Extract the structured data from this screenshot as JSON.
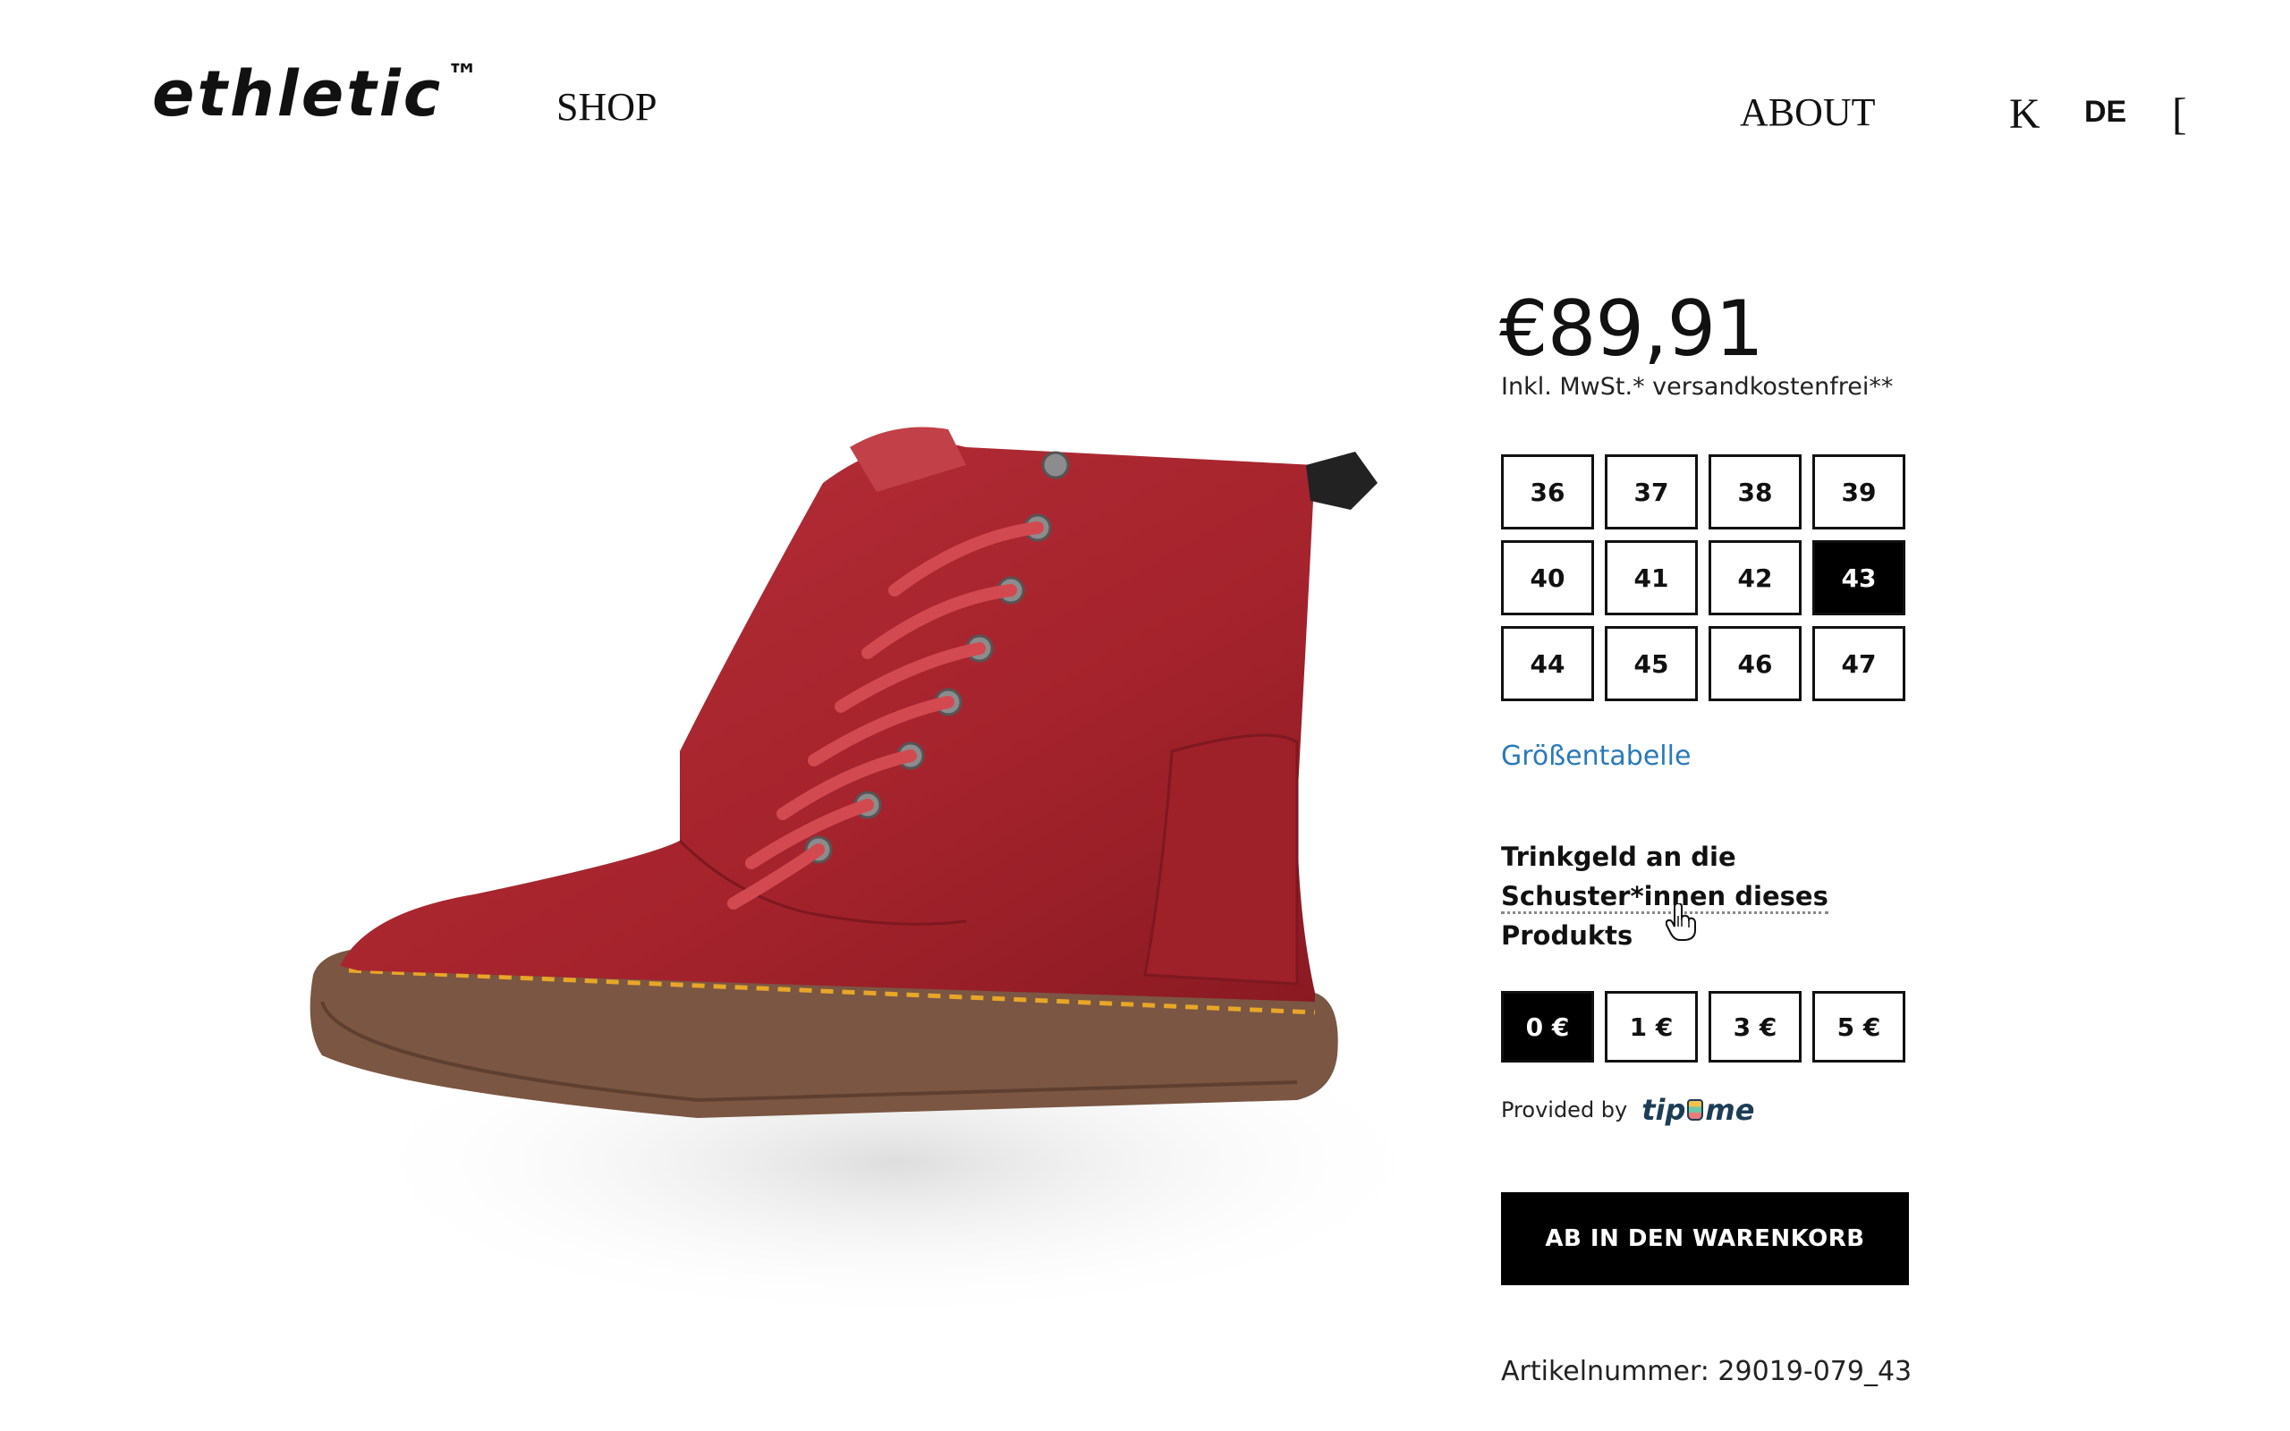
{
  "header": {
    "logo": "ethletic",
    "logo_tm": "™",
    "nav_shop": "SHOP",
    "nav_about": "ABOUT",
    "nav_k": "K",
    "nav_lang": "DE",
    "nav_bracket": "["
  },
  "product": {
    "image_icon": "red-high-top-sneaker-image",
    "price": "€89,91",
    "tax_note": "Inkl. MwSt.* versandkostenfrei**",
    "sizes": [
      "36",
      "37",
      "38",
      "39",
      "40",
      "41",
      "42",
      "43",
      "44",
      "45",
      "46",
      "47"
    ],
    "selected_size": "43",
    "size_chart_link": "Größentabelle",
    "tip_title_line1": "Trinkgeld an die",
    "tip_title_line2": "Schuster*innen dieses",
    "tip_title_line3": "Produkts",
    "tips": [
      "0 €",
      "1 €",
      "3 €",
      "5 €"
    ],
    "selected_tip": "0 €",
    "provided_by": "Provided by",
    "tipme_brand_a": "tip",
    "tipme_brand_b": "me",
    "add_to_cart": "AB IN DEN WARENKORB",
    "article_number": "Artikelnummer: 29019-079_43"
  },
  "colors": {
    "accent_link": "#2a7ab8",
    "shoe_red": "#a8242c",
    "sole_brown": "#7a5643",
    "stitch_yellow": "#e8a628",
    "black": "#000000"
  }
}
